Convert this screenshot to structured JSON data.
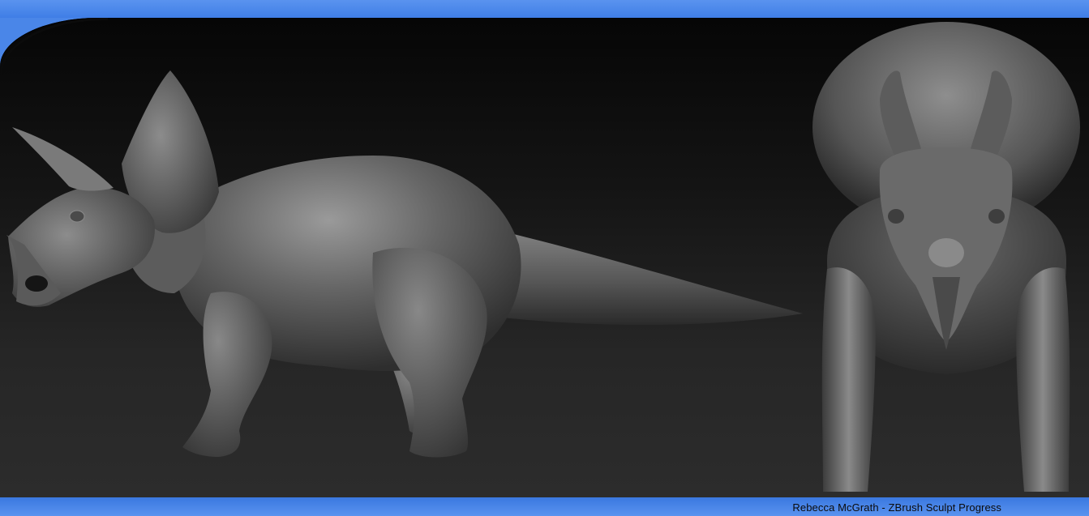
{
  "caption": {
    "text": "Rebecca McGrath - ZBrush Sculpt Progress"
  },
  "colors": {
    "frame": "#4a86e8",
    "viewport_dark": "#060606",
    "clay": "#6a6a6a"
  },
  "icons": {
    "side": "triceratops-side-view",
    "front": "triceratops-front-view"
  }
}
